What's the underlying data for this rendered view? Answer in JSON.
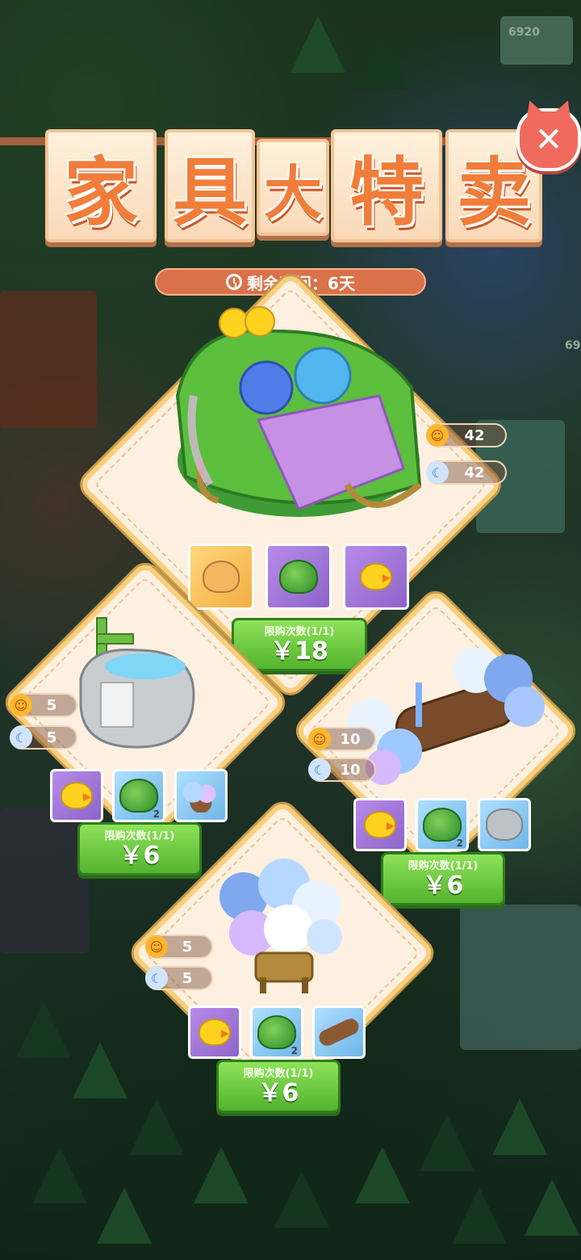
{
  "title_chars": [
    "家",
    "具",
    "大",
    "特",
    "卖"
  ],
  "timer": {
    "text": "剩余时间：6天"
  },
  "packs": [
    {
      "id": "main",
      "stats": {
        "happiness": "42",
        "sleep": "42"
      },
      "rewards": [
        {
          "icon": "cat-plush-icon",
          "qty": ""
        },
        {
          "icon": "berry-bush-icon",
          "qty": ""
        },
        {
          "icon": "yellow-chick-icon",
          "qty": ""
        }
      ],
      "limit": "限购次数(1/1)",
      "price": "￥18"
    },
    {
      "id": "left",
      "stats": {
        "happiness": "5",
        "sleep": "5"
      },
      "rewards": [
        {
          "icon": "yellow-chick-icon",
          "qty": ""
        },
        {
          "icon": "green-bush-icon",
          "qty": "2"
        },
        {
          "icon": "hydrangea-planter-icon",
          "qty": ""
        }
      ],
      "limit": "限购次数(1/1)",
      "price": "￥6"
    },
    {
      "id": "right",
      "stats": {
        "happiness": "10",
        "sleep": "10"
      },
      "rewards": [
        {
          "icon": "yellow-chick-icon",
          "qty": ""
        },
        {
          "icon": "green-bush-icon",
          "qty": "2"
        },
        {
          "icon": "stone-basin-icon",
          "qty": ""
        }
      ],
      "limit": "限购次数(1/1)",
      "price": "￥6"
    },
    {
      "id": "bottom",
      "stats": {
        "happiness": "5",
        "sleep": "5"
      },
      "rewards": [
        {
          "icon": "yellow-chick-icon",
          "qty": ""
        },
        {
          "icon": "green-bush-icon",
          "qty": "2"
        },
        {
          "icon": "flower-log-icon",
          "qty": ""
        }
      ],
      "limit": "限购次数(1/1)",
      "price": "￥6"
    }
  ],
  "background": {
    "currency_top": "6920",
    "currency_side": "69"
  },
  "icons": {
    "close": "close-icon",
    "clock": "clock-icon",
    "happiness": "smile-sun-icon",
    "sleep": "moon-icon"
  }
}
